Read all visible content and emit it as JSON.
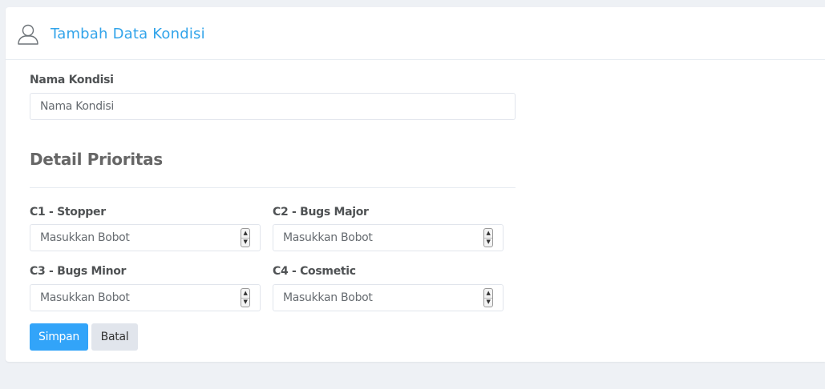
{
  "header": {
    "title": "Tambah Data Kondisi",
    "icon": "user-icon"
  },
  "form": {
    "nama_label": "Nama Kondisi",
    "nama_placeholder": "Nama Kondisi",
    "section_title": "Detail Prioritas",
    "fields": [
      {
        "label": "C1 - Stopper",
        "placeholder": "Masukkan Bobot"
      },
      {
        "label": "C2 - Bugs Major",
        "placeholder": "Masukkan Bobot"
      },
      {
        "label": "C3 - Bugs Minor",
        "placeholder": "Masukkan Bobot"
      },
      {
        "label": "C4 - Cosmetic",
        "placeholder": "Masukkan Bobot"
      }
    ],
    "save_label": "Simpan",
    "cancel_label": "Batal"
  },
  "colors": {
    "accent": "#32a4f9",
    "title": "#32a4ea",
    "background": "#eef1f5"
  }
}
